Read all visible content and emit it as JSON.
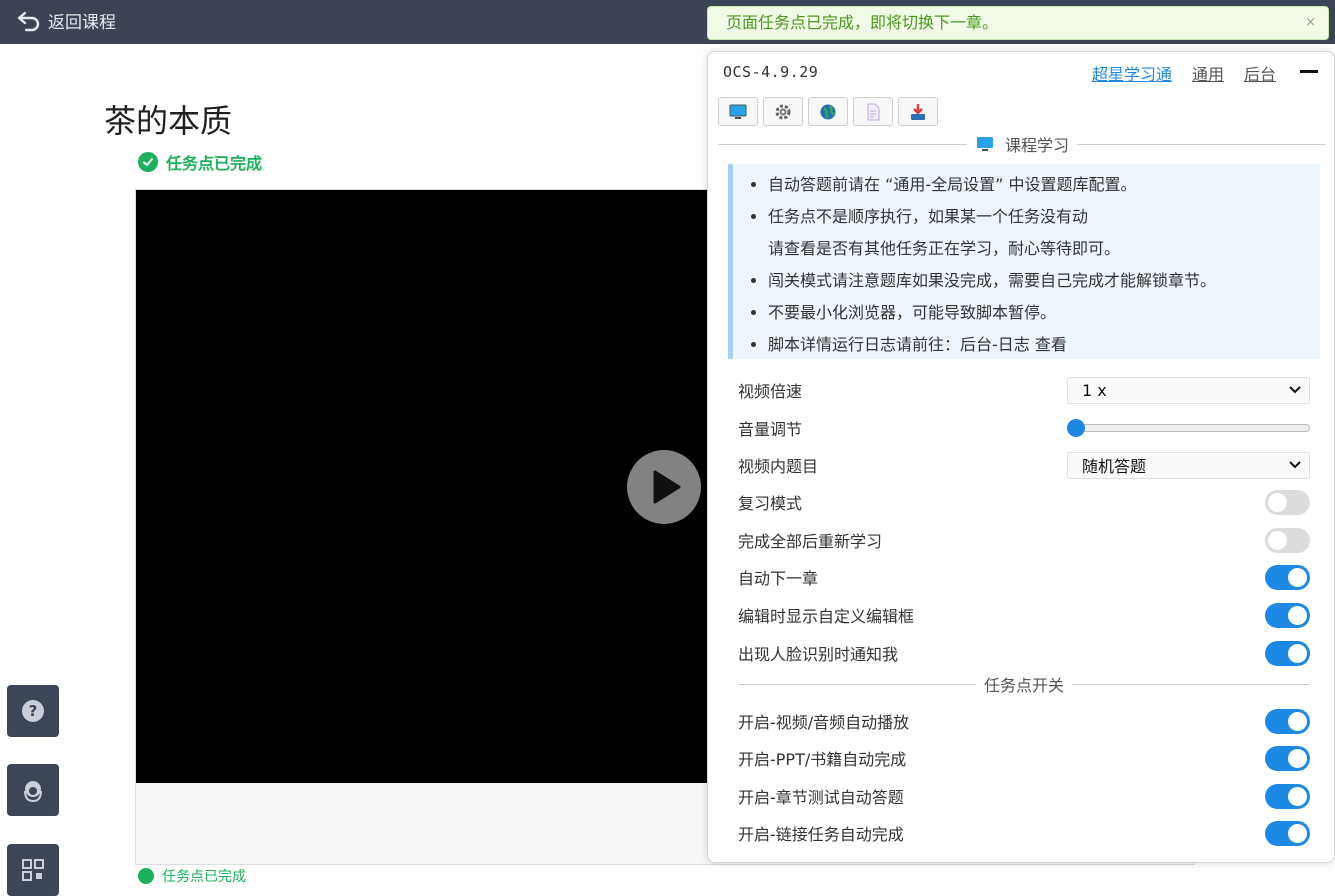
{
  "topbar": {
    "back_label": "返回课程"
  },
  "page": {
    "title": "茶的本质",
    "task_status": "任务点已完成",
    "peek_status": "任务点已完成"
  },
  "notice": {
    "text": "页面任务点已完成，即将切换下一章。",
    "close": "×"
  },
  "panel": {
    "version": "OCS-4.9.29",
    "nav": [
      {
        "label": "超星学习通",
        "active": true
      },
      {
        "label": "通用",
        "active": false
      },
      {
        "label": "后台",
        "active": false
      }
    ],
    "toolbar_icons": [
      "monitor-icon",
      "gear-icon",
      "globe-icon",
      "document-icon",
      "download-icon"
    ],
    "section_title": "课程学习",
    "tips": [
      "自动答题前请在 “通用-全局设置” 中设置题库配置。",
      "任务点不是顺序执行，如果某一个任务没有动",
      "请查看是否有其他任务正在学习，耐心等待即可。",
      "闯关模式请注意题库如果没完成，需要自己完成才能解锁章节。",
      "不要最小化浏览器，可能导致脚本暂停。",
      "脚本详情运行日志请前往：后台-日志 查看"
    ],
    "settings": {
      "playback_rate": {
        "label": "视频倍速",
        "value": "1 x"
      },
      "volume": {
        "label": "音量调节",
        "value": 0
      },
      "video_question": {
        "label": "视频内题目",
        "value": "随机答题"
      },
      "toggles": [
        {
          "label": "复习模式",
          "on": false
        },
        {
          "label": "完成全部后重新学习",
          "on": false
        },
        {
          "label": "自动下一章",
          "on": true
        },
        {
          "label": "编辑时显示自定义编辑框",
          "on": true
        },
        {
          "label": "出现人脸识别时通知我",
          "on": true
        }
      ]
    },
    "task_section_title": "任务点开关",
    "task_toggles": [
      {
        "label": "开启-视频/音频自动播放",
        "on": true
      },
      {
        "label": "开启-PPT/书籍自动完成",
        "on": true
      },
      {
        "label": "开启-章节测试自动答题",
        "on": true
      },
      {
        "label": "开启-链接任务自动完成",
        "on": true
      }
    ]
  },
  "colors": {
    "accent": "#1e88e5",
    "success": "#1bb15b",
    "topbar": "#3c4354"
  }
}
